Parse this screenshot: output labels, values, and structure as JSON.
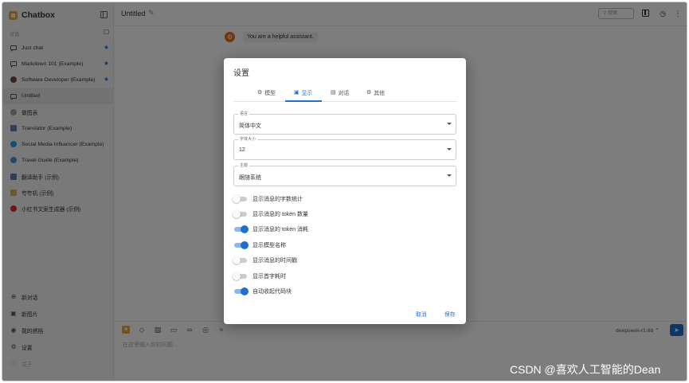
{
  "app": {
    "name": "Chatbox"
  },
  "sidebar": {
    "section_label": "对话",
    "conversations": [
      {
        "label": "Just chat",
        "starred": true,
        "icon": "chat-icon"
      },
      {
        "label": "Markdown 101 (Example)",
        "starred": true,
        "icon": "chat-icon"
      },
      {
        "label": "Software Developer (Example)",
        "starred": true,
        "icon": "developer-avatar-icon"
      },
      {
        "label": "Untitled",
        "starred": false,
        "icon": "chat-icon",
        "active": true
      },
      {
        "label": "做图表",
        "starred": false,
        "icon": "chart-avatar-icon"
      },
      {
        "label": "Translator (Example)",
        "starred": false,
        "icon": "translator-avatar-icon"
      },
      {
        "label": "Social Media Influencer (Example)",
        "starred": false,
        "icon": "twitter-avatar-icon"
      },
      {
        "label": "Travel Guide (Example)",
        "starred": false,
        "icon": "globe-avatar-icon"
      },
      {
        "label": "翻译助手 (示例)",
        "starred": false,
        "icon": "translator-avatar-icon"
      },
      {
        "label": "夸夸机 (示例)",
        "starred": false,
        "icon": "praise-avatar-icon"
      },
      {
        "label": "小红书文案生成器 (示例)",
        "starred": false,
        "icon": "xiaohongshu-avatar-icon"
      }
    ],
    "bottom_menu": [
      {
        "label": "新对话",
        "icon": "plus-circle-icon",
        "glyph": "⊕"
      },
      {
        "label": "新图片",
        "icon": "image-icon",
        "glyph": "▣"
      },
      {
        "label": "我的搭档",
        "icon": "partner-icon",
        "glyph": "◉"
      },
      {
        "label": "设置",
        "icon": "gear-icon",
        "glyph": "⚙"
      },
      {
        "label": "关于",
        "icon": "info-icon",
        "glyph": "ⓘ",
        "muted": true
      }
    ]
  },
  "header": {
    "title": "Untitled",
    "search_placeholder": "搜索"
  },
  "chat": {
    "system_message": "You are a helpful assistant."
  },
  "composer": {
    "placeholder": "在这里输入你的问题...",
    "model": "deepseek-r1:8b ⌃"
  },
  "settings": {
    "title": "设置",
    "tabs": [
      {
        "label": "模型",
        "icon": "robot-icon",
        "glyph": "⚙"
      },
      {
        "label": "显示",
        "icon": "display-icon",
        "glyph": "▣",
        "active": true
      },
      {
        "label": "对话",
        "icon": "chat-icon",
        "glyph": "▤"
      },
      {
        "label": "其他",
        "icon": "gear-icon",
        "glyph": "⚙"
      }
    ],
    "fields": {
      "language": {
        "label": "语言",
        "value": "简体中文"
      },
      "font_size": {
        "label": "字体大小",
        "value": "12"
      },
      "theme": {
        "label": "主题",
        "value": "跟随系统"
      }
    },
    "toggles": [
      {
        "label": "显示消息的字数统计",
        "on": false
      },
      {
        "label": "显示消息的 token 数量",
        "on": false
      },
      {
        "label": "显示消息的 token 消耗",
        "on": true
      },
      {
        "label": "显示模型名称",
        "on": true
      },
      {
        "label": "显示消息的时间戳",
        "on": false
      },
      {
        "label": "显示首字耗时",
        "on": false
      },
      {
        "label": "自动收起代码块",
        "on": true
      }
    ],
    "cancel_label": "取消",
    "save_label": "保存"
  },
  "watermark": "CSDN @喜欢人工智能的Dean",
  "colors": {
    "accent": "#1d6fd1",
    "brand": "#e8a23c"
  }
}
